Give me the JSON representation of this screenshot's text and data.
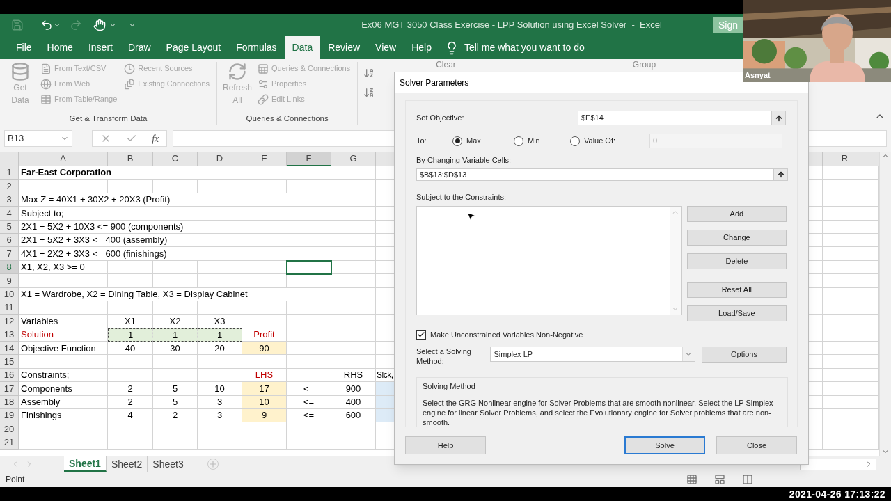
{
  "title_bar": {
    "title": "Ex06 MGT 3050 Class Exercise - LPP Solution using Excel Solver  -  Excel",
    "sign_in": "Sign"
  },
  "ribbon_tabs": [
    {
      "label": "File",
      "selected": false
    },
    {
      "label": "Home",
      "selected": false
    },
    {
      "label": "Insert",
      "selected": false
    },
    {
      "label": "Draw",
      "selected": false
    },
    {
      "label": "Page Layout",
      "selected": false
    },
    {
      "label": "Formulas",
      "selected": false
    },
    {
      "label": "Data",
      "selected": true
    },
    {
      "label": "Review",
      "selected": false
    },
    {
      "label": "View",
      "selected": false
    },
    {
      "label": "Help",
      "selected": false
    }
  ],
  "tell_me": "Tell me what you want to do",
  "ribbon": {
    "disabled": true,
    "groups": [
      {
        "name": "Get & Transform Data",
        "big_button": "Get Data",
        "items": [
          "From Text/CSV",
          "From Web",
          "From Table/Range",
          "Recent Sources",
          "Existing Connections"
        ]
      },
      {
        "name": "Queries & Connections",
        "big_button": "Refresh All",
        "items": [
          "Queries & Connections",
          "Properties",
          "Edit Links"
        ]
      }
    ],
    "partial_items": [
      "Clear",
      "Group"
    ]
  },
  "formula_bar": {
    "name_box": "B13",
    "function_label": "fx"
  },
  "sheet": {
    "columns": [
      {
        "label": "A",
        "selected": false
      },
      {
        "label": "B",
        "selected": false
      },
      {
        "label": "C",
        "selected": false
      },
      {
        "label": "D",
        "selected": false
      },
      {
        "label": "E",
        "selected": false
      },
      {
        "label": "F",
        "selected": true
      },
      {
        "label": "G",
        "selected": false
      }
    ],
    "right_columns": [
      {
        "label": "R",
        "selected": false
      }
    ],
    "rows": [
      {
        "number": "1",
        "selected": false,
        "cells": [
          {
            "text": "Far-East Corporation",
            "bold": true
          }
        ]
      },
      {
        "number": "2",
        "selected": false,
        "cells": []
      },
      {
        "number": "3",
        "selected": false,
        "cells": [
          {
            "text": "Max Z = 40X1 + 30X2 + 20X3 (Profit)"
          }
        ]
      },
      {
        "number": "4",
        "selected": false,
        "cells": [
          {
            "text": "Subject to;"
          }
        ]
      },
      {
        "number": "5",
        "selected": false,
        "cells": [
          {
            "text": "2X1 + 5X2 + 10X3 <= 900 (components)"
          }
        ]
      },
      {
        "number": "6",
        "selected": false,
        "cells": [
          {
            "text": "2X1 + 5X2 + 3X3 <= 400 (assembly)"
          }
        ]
      },
      {
        "number": "7",
        "selected": false,
        "cells": [
          {
            "text": "4X1 + 2X2 + 3X3 <= 600 (finishings)"
          }
        ]
      },
      {
        "number": "8",
        "selected": true,
        "cells": [
          {
            "text": "X1, X2, X3 >= 0"
          },
          {},
          {},
          {},
          {},
          {
            "selected": true
          }
        ]
      },
      {
        "number": "9",
        "selected": false,
        "cells": []
      },
      {
        "number": "10",
        "selected": false,
        "cells": [
          {
            "text": "X1 = Wardrobe, X2 = Dining Table, X3 = Display Cabinet"
          }
        ]
      },
      {
        "number": "11",
        "selected": false,
        "cells": []
      },
      {
        "number": "12",
        "selected": false,
        "cells": [
          {
            "text": "Variables"
          },
          {
            "text": "X1"
          },
          {
            "text": "X2"
          },
          {
            "text": "X3"
          }
        ]
      },
      {
        "number": "13",
        "selected": false,
        "cells": [
          {
            "text": "Solution",
            "red": true
          },
          {
            "text": "1",
            "color": "#e2efda",
            "marquee": true
          },
          {
            "text": "1",
            "color": "#e2efda",
            "marquee": true
          },
          {
            "text": "1",
            "color": "#e2efda",
            "marquee": true
          },
          {
            "text": "Profit",
            "red": true
          }
        ]
      },
      {
        "number": "14",
        "selected": false,
        "cells": [
          {
            "text": "Objective Function"
          },
          {
            "text": "40"
          },
          {
            "text": "30"
          },
          {
            "text": "20"
          },
          {
            "text": "90",
            "color": "#fff2cc"
          }
        ]
      },
      {
        "number": "15",
        "selected": false,
        "cells": []
      },
      {
        "number": "16",
        "selected": false,
        "cells": [
          {
            "text": "Constraints;"
          },
          {},
          {},
          {},
          {
            "text": "LHS",
            "red": true
          },
          {},
          {
            "text": "RHS"
          },
          {
            "text": "Slck,",
            "left": true
          }
        ]
      },
      {
        "number": "17",
        "selected": false,
        "cells": [
          {
            "text": "Components"
          },
          {
            "text": "2"
          },
          {
            "text": "5"
          },
          {
            "text": "10"
          },
          {
            "text": "17",
            "color": "#fff2cc"
          },
          {
            "text": "<="
          },
          {
            "text": "900"
          },
          {
            "color": "#ddebf7"
          }
        ]
      },
      {
        "number": "18",
        "selected": false,
        "cells": [
          {
            "text": "Assembly"
          },
          {
            "text": "2"
          },
          {
            "text": "5"
          },
          {
            "text": "3"
          },
          {
            "text": "10",
            "color": "#fff2cc"
          },
          {
            "text": "<="
          },
          {
            "text": "400"
          },
          {
            "color": "#ddebf7"
          }
        ]
      },
      {
        "number": "19",
        "selected": false,
        "cells": [
          {
            "text": "Finishings"
          },
          {
            "text": "4"
          },
          {
            "text": "2"
          },
          {
            "text": "3"
          },
          {
            "text": "9",
            "color": "#fff2cc"
          },
          {
            "text": "<="
          },
          {
            "text": "600"
          },
          {
            "color": "#ddebf7"
          }
        ]
      },
      {
        "number": "20",
        "selected": false,
        "cells": []
      },
      {
        "number": "21",
        "selected": false,
        "cells": []
      }
    ]
  },
  "sheet_tabs": [
    {
      "label": "Sheet1",
      "selected": true
    },
    {
      "label": "Sheet2",
      "selected": false
    },
    {
      "label": "Sheet3",
      "selected": false
    }
  ],
  "status": "Point",
  "dialog": {
    "title": "Solver Parameters",
    "objective_label": "Set Objective:",
    "objective": "$E$14",
    "to_label": "To:",
    "to_options": [
      {
        "label": "Max",
        "selected": true
      },
      {
        "label": "Min",
        "selected": false
      },
      {
        "label": "Value Of:",
        "selected": false
      }
    ],
    "value_of": "0",
    "changing_label": "By Changing Variable Cells:",
    "changing": "$B$13:$D$13",
    "constraints_label": "Subject to the Constraints:",
    "constraint_buttons": [
      "Add",
      "Change",
      "Delete",
      "Reset All",
      "Load/Save"
    ],
    "non_negative": {
      "label": "Make Unconstrained Variables Non-Negative",
      "checked": true
    },
    "method_label": "Select a Solving Method:",
    "method": "Simplex LP",
    "options_button": "Options",
    "method_box": {
      "title": "Solving Method",
      "text": "Select the GRG Nonlinear engine for Solver Problems that are smooth nonlinear. Select the LP Simplex engine for linear Solver Problems, and select the Evolutionary engine for Solver problems that are non-smooth."
    },
    "footer_buttons": [
      {
        "label": "Help",
        "default": false
      },
      {
        "label": "Solve",
        "default": true
      },
      {
        "label": "Close",
        "default": false
      }
    ]
  },
  "webcam": {
    "kind": "picture",
    "name": "Asnyat"
  },
  "timestamp": "2021-04-26 17:13:22"
}
